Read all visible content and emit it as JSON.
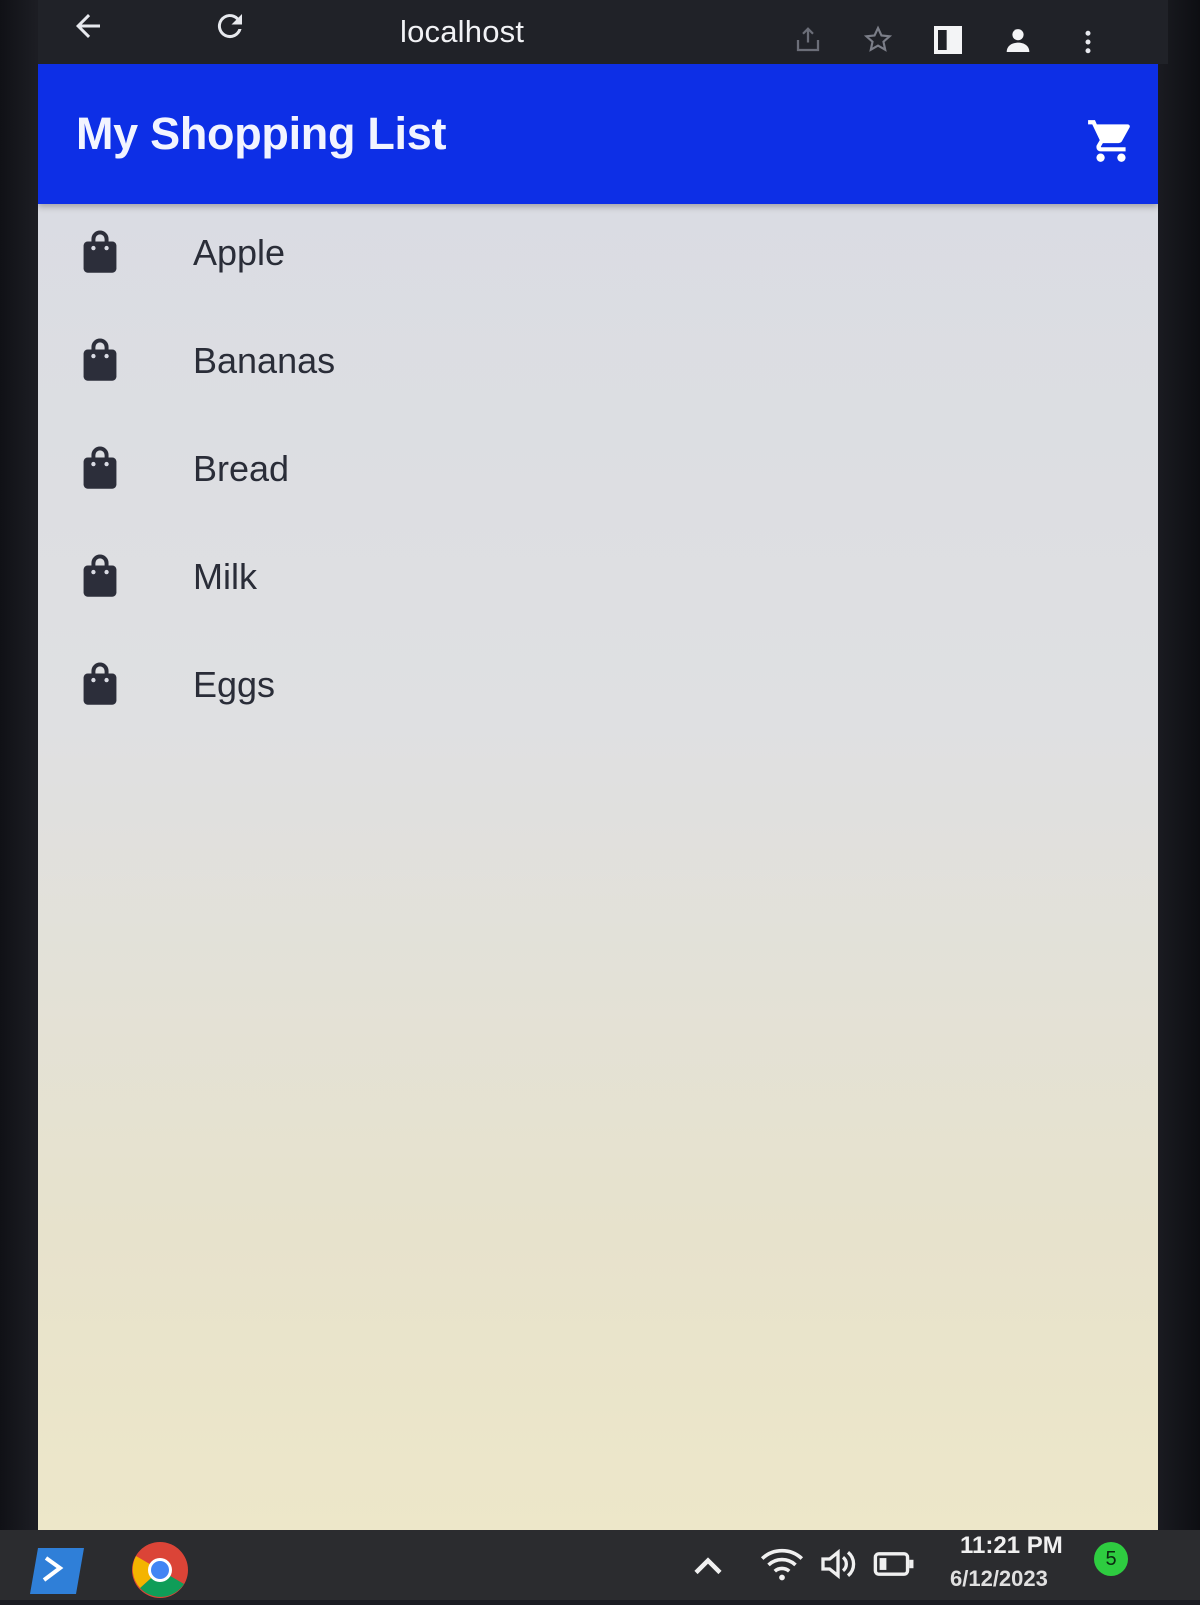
{
  "browser": {
    "url": "localhost"
  },
  "app": {
    "title": "My Shopping List",
    "accent_color": "#0d2fe6",
    "header_icon": "cart-icon"
  },
  "list": {
    "item_icon": "shopping-bag-icon",
    "items": [
      {
        "label": "Apple"
      },
      {
        "label": "Bananas"
      },
      {
        "label": "Bread"
      },
      {
        "label": "Milk"
      },
      {
        "label": "Eggs"
      }
    ]
  },
  "taskbar": {
    "time": "11:21 PM",
    "date": "6/12/2023",
    "notification_count": "5",
    "icons": [
      "terminal-icon",
      "chrome-icon",
      "chevron-up-icon",
      "wifi-icon",
      "volume-icon",
      "battery-icon"
    ]
  }
}
